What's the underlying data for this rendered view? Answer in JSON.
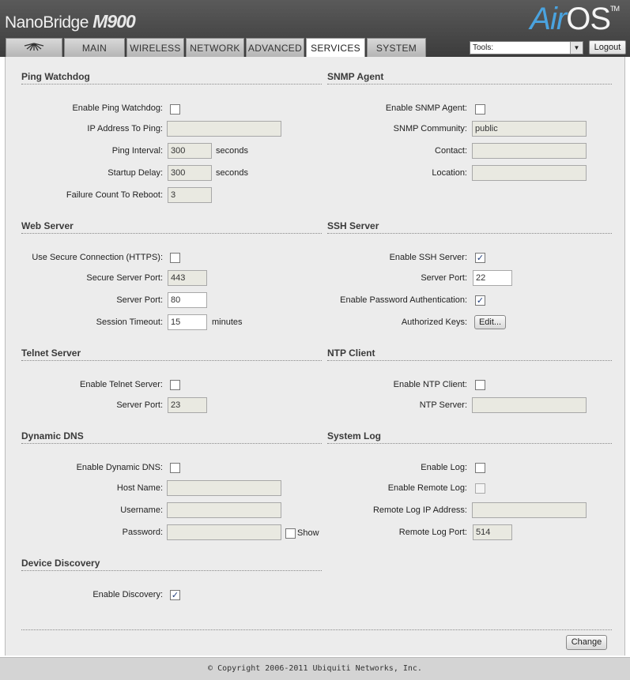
{
  "header": {
    "brand_name": "NanoBridge",
    "brand_model": "M900",
    "logo_air": "Air",
    "logo_os": "OS",
    "logo_tm": "TM"
  },
  "tabs": [
    {
      "label": "",
      "icon": "ubiquiti-logo-icon",
      "active": false
    },
    {
      "label": "MAIN",
      "active": false
    },
    {
      "label": "WIRELESS",
      "active": false
    },
    {
      "label": "NETWORK",
      "active": false
    },
    {
      "label": "ADVANCED",
      "active": false
    },
    {
      "label": "SERVICES",
      "active": true
    },
    {
      "label": "SYSTEM",
      "active": false
    }
  ],
  "toolbar": {
    "tools_value": "Tools:",
    "logout_label": "Logout"
  },
  "ping_watchdog": {
    "title": "Ping Watchdog",
    "enable_label": "Enable Ping Watchdog:",
    "enabled": false,
    "ip_label": "IP Address To Ping:",
    "ip_value": "",
    "interval_label": "Ping Interval:",
    "interval_value": "300",
    "interval_unit": "seconds",
    "startup_label": "Startup Delay:",
    "startup_value": "300",
    "startup_unit": "seconds",
    "failure_label": "Failure Count To Reboot:",
    "failure_value": "3"
  },
  "snmp": {
    "title": "SNMP Agent",
    "enable_label": "Enable SNMP Agent:",
    "enabled": false,
    "community_label": "SNMP Community:",
    "community_value": "public",
    "contact_label": "Contact:",
    "contact_value": "",
    "location_label": "Location:",
    "location_value": ""
  },
  "web_server": {
    "title": "Web Server",
    "https_label": "Use Secure Connection (HTTPS):",
    "https_enabled": false,
    "secure_port_label": "Secure Server Port:",
    "secure_port_value": "443",
    "port_label": "Server Port:",
    "port_value": "80",
    "timeout_label": "Session Timeout:",
    "timeout_value": "15",
    "timeout_unit": "minutes"
  },
  "ssh": {
    "title": "SSH Server",
    "enable_label": "Enable SSH Server:",
    "enabled": true,
    "port_label": "Server Port:",
    "port_value": "22",
    "password_auth_label": "Enable Password Authentication:",
    "password_auth_enabled": true,
    "keys_label": "Authorized Keys:",
    "edit_label": "Edit..."
  },
  "telnet": {
    "title": "Telnet Server",
    "enable_label": "Enable Telnet Server:",
    "enabled": false,
    "port_label": "Server Port:",
    "port_value": "23"
  },
  "ntp": {
    "title": "NTP Client",
    "enable_label": "Enable NTP Client:",
    "enabled": false,
    "server_label": "NTP Server:",
    "server_value": ""
  },
  "ddns": {
    "title": "Dynamic DNS",
    "enable_label": "Enable Dynamic DNS:",
    "enabled": false,
    "host_label": "Host Name:",
    "host_value": "",
    "username_label": "Username:",
    "username_value": "",
    "password_label": "Password:",
    "password_value": "",
    "show_label": "Show",
    "show_enabled": false
  },
  "syslog": {
    "title": "System Log",
    "enable_label": "Enable Log:",
    "enabled": false,
    "remote_label": "Enable Remote Log:",
    "remote_enabled": false,
    "remote_ip_label": "Remote Log IP Address:",
    "remote_ip_value": "",
    "remote_port_label": "Remote Log Port:",
    "remote_port_value": "514"
  },
  "discovery": {
    "title": "Device Discovery",
    "enable_label": "Enable Discovery:",
    "enabled": true
  },
  "actions": {
    "change_label": "Change"
  },
  "footer": {
    "copyright": "© Copyright 2006-2011 Ubiquiti Networks, Inc."
  }
}
